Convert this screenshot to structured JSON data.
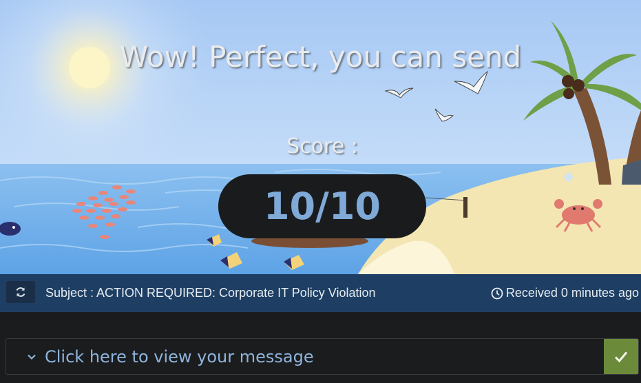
{
  "result": {
    "headline": "Wow! Perfect, you can send",
    "score_label": "Score :",
    "score_value": "10/10"
  },
  "email": {
    "subject": "Subject : ACTION REQUIRED: Corporate IT Policy Violation",
    "received": "Received 0 minutes ago"
  },
  "message": {
    "toggle_label": "Click here to view your message"
  },
  "icons": {
    "refresh": "refresh-icon",
    "clock": "clock-icon",
    "chevron": "chevron-down-icon",
    "check": "check-icon"
  },
  "colors": {
    "sky": "#a9ccf5",
    "sea": "#7ab4ec",
    "sand": "#f3e6b3",
    "subject_bar": "#1e3f63",
    "score_text": "#7fa9d6",
    "accept_button": "#6b8a3a",
    "page_background": "#1b1c1e"
  }
}
